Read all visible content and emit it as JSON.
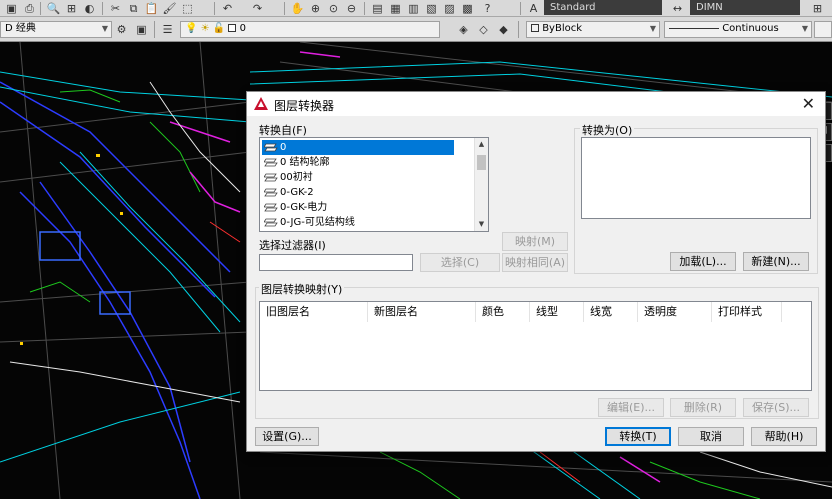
{
  "toolbar": {
    "workspace": "D 经典",
    "layer_value": "0",
    "text_style": "Standard",
    "dim_style": "DIMN",
    "color": "ByBlock",
    "linetype": "Continuous"
  },
  "dialog": {
    "title": "图层转换器",
    "convert_from_label": "转换自(F)",
    "convert_from_items": [
      "0",
      "0 结构轮廓",
      "00初衬",
      "0-GK-2",
      "0-GK-电力",
      "0-JG-可见结构线"
    ],
    "selected_index": 0,
    "convert_to_label": "转换为(O)",
    "selection_filter_label": "选择过滤器(I)",
    "selection_filter_value": "",
    "select_button": "选择(C)",
    "map_button": "映射(M)",
    "map_same_button": "映射相同(A)",
    "load_button": "加载(L)...",
    "new_button": "新建(N)...",
    "mappings_label": "图层转换映射(Y)",
    "columns": [
      "旧图层名",
      "新图层名",
      "颜色",
      "线型",
      "线宽",
      "透明度",
      "打印样式"
    ],
    "edit_button": "编辑(E)...",
    "delete_button": "删除(R)",
    "save_button": "保存(S)...",
    "settings_button": "设置(G)...",
    "translate_button": "转换(T)",
    "cancel_button": "取消",
    "help_button": "帮助(H)"
  }
}
